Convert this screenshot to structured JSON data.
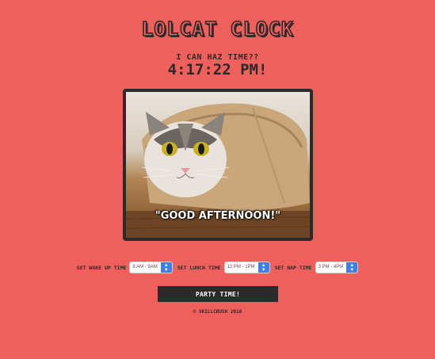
{
  "header": {
    "title": "Lolcat Clock",
    "subtitle": "I can haz time??",
    "clock": "4:17:22 PM!"
  },
  "photo": {
    "caption": "\"Good afternoon!\""
  },
  "controls": {
    "wake": {
      "label": "Set wake up time",
      "value": "8 AM - 9AM"
    },
    "lunch": {
      "label": "Set lunch time",
      "value": "12 PM - 1PM"
    },
    "nap": {
      "label": "Set nap time",
      "value": "3 PM - 4PM"
    }
  },
  "button": {
    "label": "Party time!"
  },
  "footer": {
    "text": "© Skillcrush 2016"
  },
  "colors": {
    "background": "#ef5f5c",
    "dark": "#2b2b2b",
    "select_accent": "#3d7ee8"
  }
}
